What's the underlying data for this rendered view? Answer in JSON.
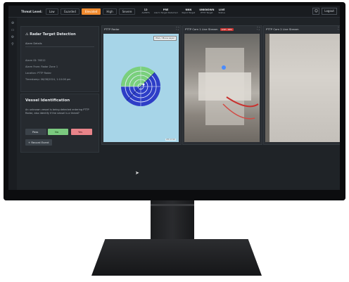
{
  "topbar": {
    "threat_label": "Threat Level:",
    "levels": [
      {
        "label": "Low",
        "active": false
      },
      {
        "label": "Guarded",
        "active": false
      },
      {
        "label": "Elevated",
        "active": true
      },
      {
        "label": "High",
        "active": false
      },
      {
        "label": "Severe",
        "active": false
      }
    ],
    "stats": [
      {
        "value": "12",
        "label": "ALERTS"
      },
      {
        "value": "PRE",
        "label": "Alarm Target Detected"
      },
      {
        "value": "NNN",
        "label": "Rapid Target"
      },
      {
        "value": "UNKNOWN",
        "label": "PTTP Target"
      },
      {
        "value": "LIVE",
        "label": "Status"
      }
    ],
    "user_icon": "user-icon",
    "logout_label": "Logout"
  },
  "sidenav": {
    "icons": [
      "globe-icon",
      "folder-icon",
      "settings-icon",
      "filter-icon"
    ]
  },
  "alert_panel": {
    "title": "Radar Target Detection",
    "subtitle": "Alarm Details",
    "lines": [
      "Alarm ID: 76512",
      "Alarm From: Radar Zone 1",
      "Location: PTTP Radar",
      "Timestamp: 06/08/2024, 1:10:06 pm"
    ]
  },
  "vessel_panel": {
    "title": "Vessel Identification",
    "question": "An unknown vessel is being detected entering PTTP Radar, also identify if the vessel is a threat?",
    "buttons": {
      "inspect": "Pass",
      "no": "No",
      "yes": "Yes",
      "record": "Record Event"
    }
  },
  "cameras": [
    {
      "title": "PTTP Radar",
      "live": "",
      "button": "Plan / Move Layer",
      "stamp": "UTC 13:10"
    },
    {
      "title": "PTTP Cam 1 Live Stream",
      "live": "LIVE / REC"
    },
    {
      "title": "PTTP Cam 2 Live Stream",
      "live": ""
    }
  ],
  "colors": {
    "accent": "#f08a2e",
    "radar_bg": "#a7d5e8",
    "radar_green": "#7ad07d",
    "radar_blue": "#2e3ec7"
  }
}
